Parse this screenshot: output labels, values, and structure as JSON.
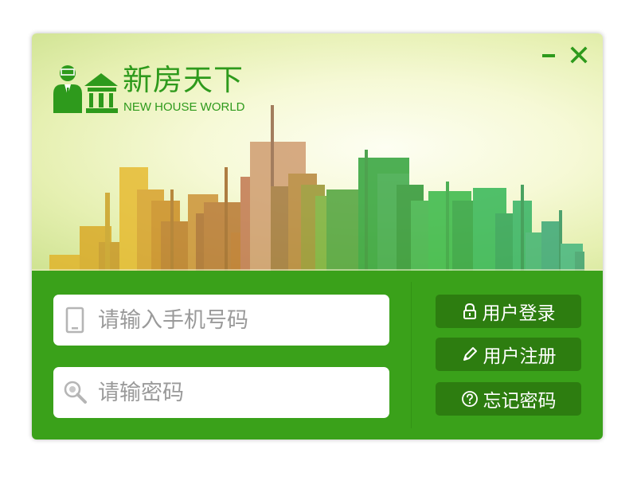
{
  "brand": {
    "name": "新房天下",
    "tagline": "NEW HOUSE WORLD",
    "color": "#2e9a1c"
  },
  "window_controls": {
    "minimize_icon": "minimize-icon",
    "close_icon": "close-icon"
  },
  "login_form": {
    "phone": {
      "placeholder": "请输入手机号码",
      "value": "",
      "icon": "phone-icon"
    },
    "password": {
      "placeholder": "请输密码",
      "value": "",
      "icon": "search-key-icon"
    }
  },
  "actions": [
    {
      "label": "用户登录",
      "icon": "lock-icon"
    },
    {
      "label": "用户注册",
      "icon": "pencil-icon"
    },
    {
      "label": "忘记密码",
      "icon": "question-icon"
    }
  ],
  "colors": {
    "panel_green": "#3aa11a",
    "button_green": "#2d7d10",
    "banner_light": "#f6f9d6"
  }
}
